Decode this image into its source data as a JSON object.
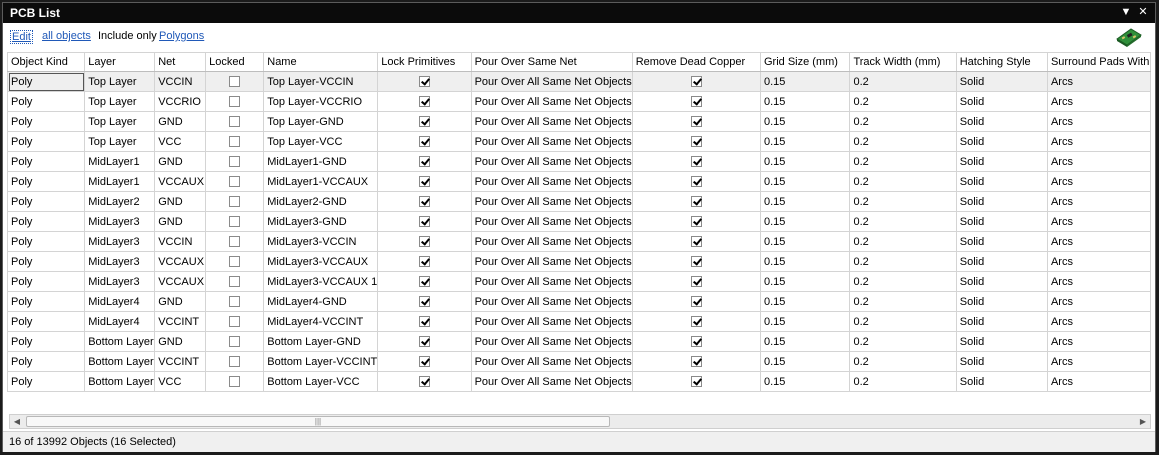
{
  "window": {
    "title": "PCB List"
  },
  "toolbar": {
    "edit_label": "Edit",
    "scope_label": "all objects",
    "include_label": "Include only",
    "filter_label": "Polygons"
  },
  "columns": [
    "Object Kind",
    "Layer",
    "Net",
    "Locked",
    "Name",
    "Lock Primitives",
    "Pour Over Same Net",
    "Remove Dead Copper",
    "Grid Size (mm)",
    "Track Width (mm)",
    "Hatching Style",
    "Surround Pads With"
  ],
  "rows": [
    {
      "kind": "Poly",
      "layer": "Top Layer",
      "net": "VCCIN",
      "locked": false,
      "name": "Top Layer-VCCIN",
      "lock_primitives": true,
      "pour_over": "Pour Over All Same Net Objects",
      "remove_dead_copper": true,
      "grid_size": "0.15",
      "track_width": "0.2",
      "hatching": "Solid",
      "surround": "Arcs"
    },
    {
      "kind": "Poly",
      "layer": "Top Layer",
      "net": "VCCRIO",
      "locked": false,
      "name": "Top Layer-VCCRIO",
      "lock_primitives": true,
      "pour_over": "Pour Over All Same Net Objects",
      "remove_dead_copper": true,
      "grid_size": "0.15",
      "track_width": "0.2",
      "hatching": "Solid",
      "surround": "Arcs"
    },
    {
      "kind": "Poly",
      "layer": "Top Layer",
      "net": "GND",
      "locked": false,
      "name": "Top Layer-GND",
      "lock_primitives": true,
      "pour_over": "Pour Over All Same Net Objects",
      "remove_dead_copper": true,
      "grid_size": "0.15",
      "track_width": "0.2",
      "hatching": "Solid",
      "surround": "Arcs"
    },
    {
      "kind": "Poly",
      "layer": "Top Layer",
      "net": "VCC",
      "locked": false,
      "name": "Top Layer-VCC",
      "lock_primitives": true,
      "pour_over": "Pour Over All Same Net Objects",
      "remove_dead_copper": true,
      "grid_size": "0.15",
      "track_width": "0.2",
      "hatching": "Solid",
      "surround": "Arcs"
    },
    {
      "kind": "Poly",
      "layer": "MidLayer1",
      "net": "GND",
      "locked": false,
      "name": "MidLayer1-GND",
      "lock_primitives": true,
      "pour_over": "Pour Over All Same Net Objects",
      "remove_dead_copper": true,
      "grid_size": "0.15",
      "track_width": "0.2",
      "hatching": "Solid",
      "surround": "Arcs"
    },
    {
      "kind": "Poly",
      "layer": "MidLayer1",
      "net": "VCCAUX",
      "locked": false,
      "name": "MidLayer1-VCCAUX",
      "lock_primitives": true,
      "pour_over": "Pour Over All Same Net Objects",
      "remove_dead_copper": true,
      "grid_size": "0.15",
      "track_width": "0.2",
      "hatching": "Solid",
      "surround": "Arcs"
    },
    {
      "kind": "Poly",
      "layer": "MidLayer2",
      "net": "GND",
      "locked": false,
      "name": "MidLayer2-GND",
      "lock_primitives": true,
      "pour_over": "Pour Over All Same Net Objects",
      "remove_dead_copper": true,
      "grid_size": "0.15",
      "track_width": "0.2",
      "hatching": "Solid",
      "surround": "Arcs"
    },
    {
      "kind": "Poly",
      "layer": "MidLayer3",
      "net": "GND",
      "locked": false,
      "name": "MidLayer3-GND",
      "lock_primitives": true,
      "pour_over": "Pour Over All Same Net Objects",
      "remove_dead_copper": true,
      "grid_size": "0.15",
      "track_width": "0.2",
      "hatching": "Solid",
      "surround": "Arcs"
    },
    {
      "kind": "Poly",
      "layer": "MidLayer3",
      "net": "VCCIN",
      "locked": false,
      "name": "MidLayer3-VCCIN",
      "lock_primitives": true,
      "pour_over": "Pour Over All Same Net Objects",
      "remove_dead_copper": true,
      "grid_size": "0.15",
      "track_width": "0.2",
      "hatching": "Solid",
      "surround": "Arcs"
    },
    {
      "kind": "Poly",
      "layer": "MidLayer3",
      "net": "VCCAUX",
      "locked": false,
      "name": "MidLayer3-VCCAUX",
      "lock_primitives": true,
      "pour_over": "Pour Over All Same Net Objects",
      "remove_dead_copper": true,
      "grid_size": "0.15",
      "track_width": "0.2",
      "hatching": "Solid",
      "surround": "Arcs"
    },
    {
      "kind": "Poly",
      "layer": "MidLayer3",
      "net": "VCCAUX",
      "locked": false,
      "name": "MidLayer3-VCCAUX 1",
      "lock_primitives": true,
      "pour_over": "Pour Over All Same Net Objects",
      "remove_dead_copper": true,
      "grid_size": "0.15",
      "track_width": "0.2",
      "hatching": "Solid",
      "surround": "Arcs"
    },
    {
      "kind": "Poly",
      "layer": "MidLayer4",
      "net": "GND",
      "locked": false,
      "name": "MidLayer4-GND",
      "lock_primitives": true,
      "pour_over": "Pour Over All Same Net Objects",
      "remove_dead_copper": true,
      "grid_size": "0.15",
      "track_width": "0.2",
      "hatching": "Solid",
      "surround": "Arcs"
    },
    {
      "kind": "Poly",
      "layer": "MidLayer4",
      "net": "VCCINT",
      "locked": false,
      "name": "MidLayer4-VCCINT",
      "lock_primitives": true,
      "pour_over": "Pour Over All Same Net Objects",
      "remove_dead_copper": true,
      "grid_size": "0.15",
      "track_width": "0.2",
      "hatching": "Solid",
      "surround": "Arcs"
    },
    {
      "kind": "Poly",
      "layer": "Bottom Layer",
      "net": "GND",
      "locked": false,
      "name": "Bottom Layer-GND",
      "lock_primitives": true,
      "pour_over": "Pour Over All Same Net Objects",
      "remove_dead_copper": true,
      "grid_size": "0.15",
      "track_width": "0.2",
      "hatching": "Solid",
      "surround": "Arcs"
    },
    {
      "kind": "Poly",
      "layer": "Bottom Layer",
      "net": "VCCINT",
      "locked": false,
      "name": "Bottom Layer-VCCINT",
      "lock_primitives": true,
      "pour_over": "Pour Over All Same Net Objects",
      "remove_dead_copper": true,
      "grid_size": "0.15",
      "track_width": "0.2",
      "hatching": "Solid",
      "surround": "Arcs"
    },
    {
      "kind": "Poly",
      "layer": "Bottom Layer",
      "net": "VCC",
      "locked": false,
      "name": "Bottom Layer-VCC",
      "lock_primitives": true,
      "pour_over": "Pour Over All Same Net Objects",
      "remove_dead_copper": true,
      "grid_size": "0.15",
      "track_width": "0.2",
      "hatching": "Solid",
      "surround": "Arcs"
    }
  ],
  "status": {
    "text": "16 of 13992 Objects (16 Selected)"
  },
  "icons": {
    "title_menu": "dropdown-arrow-icon",
    "title_close": "close-icon",
    "board": "pcb-board-icon",
    "scroll_left": "scroll-left-arrow-icon",
    "scroll_right": "scroll-right-arrow-icon"
  },
  "colors": {
    "titlebar": "#0b0b0b",
    "link": "#2059b8",
    "selected_row": "#efefef",
    "board_green": "#2f8f3a"
  }
}
